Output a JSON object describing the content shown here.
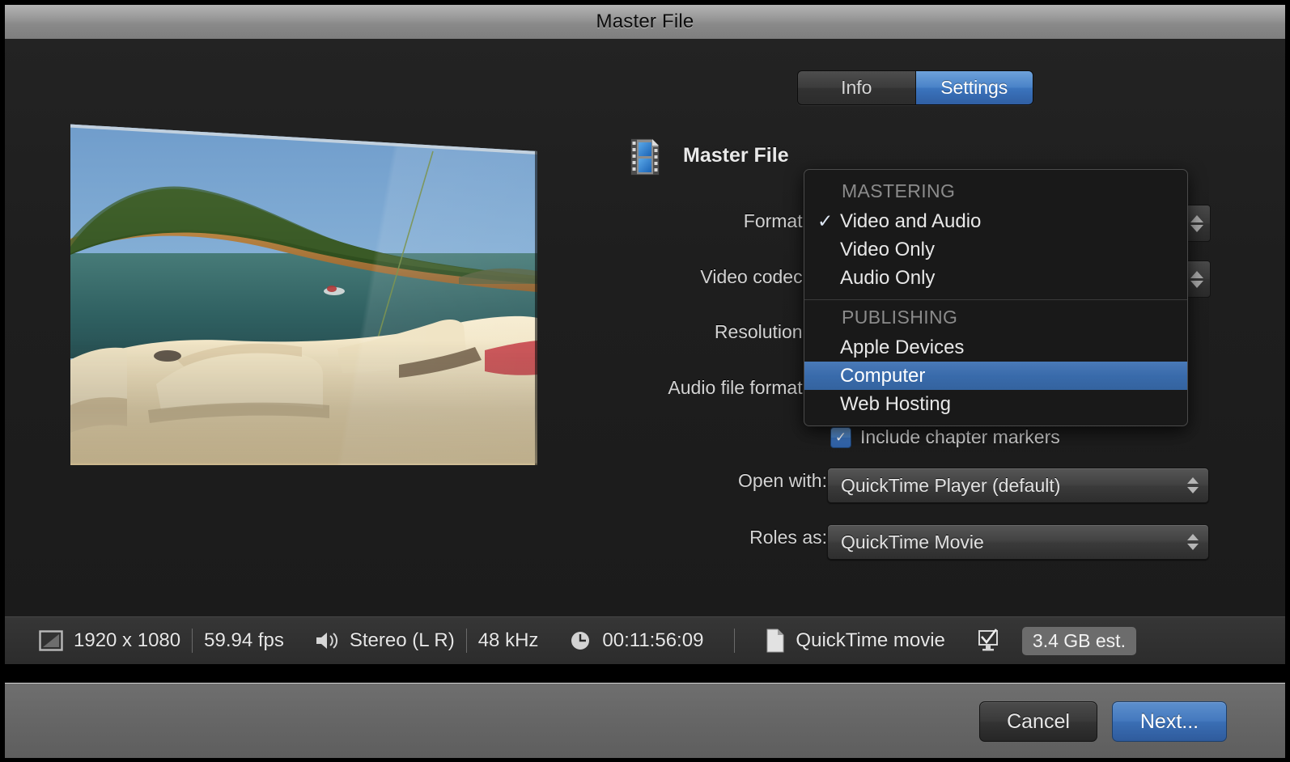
{
  "window": {
    "title": "Master File"
  },
  "tabs": [
    {
      "label": "Info",
      "selected": false
    },
    {
      "label": "Settings",
      "selected": true
    }
  ],
  "form": {
    "icon": "film-document-icon",
    "title": "Master File",
    "labels": {
      "format": "Format:",
      "video_codec": "Video codec:",
      "resolution": "Resolution:",
      "audio_file_format": "Audio file format:",
      "open_with": "Open with:",
      "roles_as": "Roles as:"
    },
    "checkbox": {
      "label": "Include chapter markers",
      "checked": true,
      "mark": "✓"
    },
    "open_with_value": "QuickTime Player (default)",
    "roles_as_value": "QuickTime Movie"
  },
  "menu": {
    "groups": [
      {
        "header": "MASTERING",
        "items": [
          {
            "label": "Video and Audio",
            "checked": true,
            "highlighted": false
          },
          {
            "label": "Video Only",
            "checked": false,
            "highlighted": false
          },
          {
            "label": "Audio Only",
            "checked": false,
            "highlighted": false
          }
        ]
      },
      {
        "header": "PUBLISHING",
        "items": [
          {
            "label": "Apple Devices",
            "checked": false,
            "highlighted": false
          },
          {
            "label": "Computer",
            "checked": false,
            "highlighted": true
          },
          {
            "label": "Web Hosting",
            "checked": false,
            "highlighted": false
          }
        ]
      }
    ],
    "check_glyph": "✓"
  },
  "status_bar": {
    "resolution": "1920 x 1080",
    "frame_rate": "59.94 fps",
    "audio_channels": "Stereo (L R)",
    "sample_rate": "48 kHz",
    "duration": "00:11:56:09",
    "file_type": "QuickTime movie",
    "file_size": "3.4 GB est.",
    "icons": {
      "resolution": "frame-size-icon",
      "audio": "speaker-icon",
      "duration": "clock-icon",
      "file": "document-icon",
      "destination": "display-check-icon"
    }
  },
  "footer": {
    "cancel": "Cancel",
    "next": "Next..."
  },
  "preview": {
    "alt": "boat-on-lake-preview"
  },
  "colors": {
    "accent_blue": "#3a72bc",
    "highlight_blue": "#396bab",
    "window_dark": "#1e1e1e",
    "footer_gray": "#666666"
  }
}
